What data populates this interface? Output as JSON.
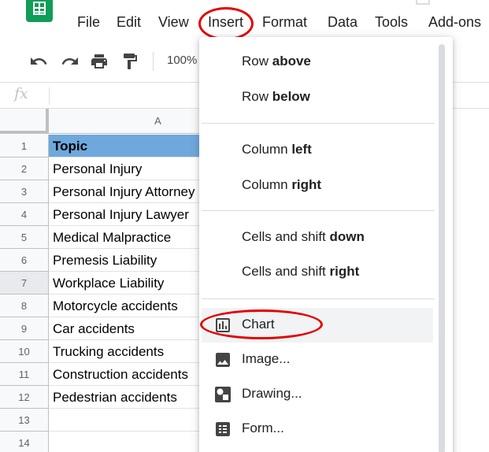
{
  "menubar": {
    "items": [
      "File",
      "Edit",
      "View",
      "Insert",
      "Format",
      "Data",
      "Tools",
      "Add-ons"
    ]
  },
  "toolbar": {
    "zoom": "100%"
  },
  "formula_bar": {
    "fx_label": "fx"
  },
  "grid": {
    "column_header": "A",
    "rows": [
      {
        "num": "1",
        "value": "Topic"
      },
      {
        "num": "2",
        "value": "Personal Injury"
      },
      {
        "num": "3",
        "value": "Personal Injury Attorney"
      },
      {
        "num": "4",
        "value": "Personal Injury Lawyer"
      },
      {
        "num": "5",
        "value": "Medical Malpractice"
      },
      {
        "num": "6",
        "value": "Premesis Liability"
      },
      {
        "num": "7",
        "value": "Workplace Liability"
      },
      {
        "num": "8",
        "value": "Motorcycle accidents"
      },
      {
        "num": "9",
        "value": "Car accidents"
      },
      {
        "num": "10",
        "value": "Trucking accidents"
      },
      {
        "num": "11",
        "value": "Construction accidents"
      },
      {
        "num": "12",
        "value": "Pedestrian accidents"
      },
      {
        "num": "13",
        "value": ""
      },
      {
        "num": "14",
        "value": ""
      }
    ]
  },
  "insert_menu": {
    "row_above": {
      "prefix": "Row ",
      "bold": "above"
    },
    "row_below": {
      "prefix": "Row ",
      "bold": "below"
    },
    "column_left": {
      "prefix": "Column ",
      "bold": "left"
    },
    "column_right": {
      "prefix": "Column ",
      "bold": "right"
    },
    "cells_down": {
      "prefix": "Cells and shift ",
      "bold": "down"
    },
    "cells_right": {
      "prefix": "Cells and shift ",
      "bold": "right"
    },
    "chart": "Chart",
    "image": "Image...",
    "drawing": "Drawing...",
    "form": "Form..."
  },
  "colors": {
    "header_fill": "#6fa8dc",
    "annotation_red": "#e30000",
    "sheets_green": "#0f9d58"
  }
}
